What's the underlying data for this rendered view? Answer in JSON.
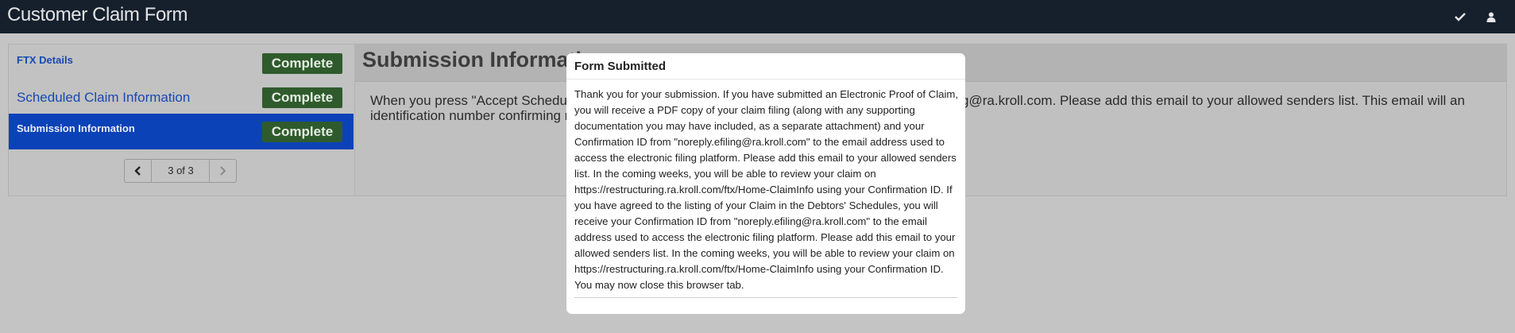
{
  "app": {
    "title": "Customer Claim Form"
  },
  "topbar": {
    "icons": [
      "check-icon",
      "user-icon"
    ]
  },
  "sidebar": {
    "items": [
      {
        "label": "FTX Details",
        "status": "Complete"
      },
      {
        "label": "Scheduled Claim Information",
        "status": "Complete"
      },
      {
        "label": "Submission Information",
        "status": "Complete",
        "active": true
      }
    ],
    "pager": {
      "text": "3 of 3"
    }
  },
  "main": {
    "title": "Submission Information",
    "text": "When you press \"Accept Scheduled Claim\", you will receive a confirmation email from noreply.efiling@ra.kroll.com. Please add this email to your allowed senders list. This email will an identification number confirming receipt of your scheduled claim."
  },
  "modal": {
    "title": "Form Submitted",
    "body": "Thank you for your submission. If you have submitted an Electronic Proof of Claim, you will receive a PDF copy of your claim filing (along with any supporting documentation you may have included, as a separate attachment) and your Confirmation ID from \"noreply.efiling@ra.kroll.com\" to the email address used to access the electronic filing platform. Please add this email to your allowed senders list. In the coming weeks, you will be able to review your claim on https://restructuring.ra.kroll.com/ftx/Home-ClaimInfo using your Confirmation ID. If you have agreed to the listing of your Claim in the Debtors' Schedules, you will receive your Confirmation ID from \"noreply.efiling@ra.kroll.com\" to the email address used to access the electronic filing platform. Please add this email to your allowed senders list. In the coming weeks, you will be able to review your claim on https://restructuring.ra.kroll.com/ftx/Home-ClaimInfo using your Confirmation ID. You may now close this browser tab."
  },
  "colors": {
    "topbar": "#16202c",
    "backdrop": "#c4c4c4",
    "badge": "#2f5b2c",
    "active_item": "#0c42b8",
    "link": "#1848b4"
  }
}
